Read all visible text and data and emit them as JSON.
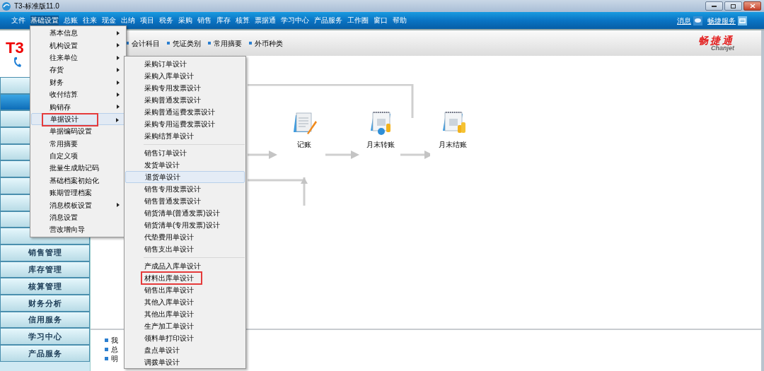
{
  "window": {
    "title": "T3-标准版11.0"
  },
  "menu_bar": {
    "items": [
      {
        "label": "文件",
        "selected": false
      },
      {
        "label": "基础设置",
        "selected": true
      },
      {
        "label": "总账",
        "selected": false
      },
      {
        "label": "往来",
        "selected": false
      },
      {
        "label": "现金",
        "selected": false
      },
      {
        "label": "出纳",
        "selected": false
      },
      {
        "label": "项目",
        "selected": false
      },
      {
        "label": "税务",
        "selected": false
      },
      {
        "label": "采购",
        "selected": false
      },
      {
        "label": "销售",
        "selected": false
      },
      {
        "label": "库存",
        "selected": false
      },
      {
        "label": "核算",
        "selected": false
      },
      {
        "label": "票据通",
        "selected": false
      },
      {
        "label": "学习中心",
        "selected": false
      },
      {
        "label": "产品服务",
        "selected": false
      },
      {
        "label": "工作圈",
        "selected": false
      },
      {
        "label": "窗口",
        "selected": false
      },
      {
        "label": "帮助",
        "selected": false
      }
    ],
    "links": [
      {
        "label": "消息",
        "kind": "message"
      },
      {
        "label": "畅捷服务",
        "kind": "service"
      }
    ]
  },
  "logo": {
    "text": "T3"
  },
  "brand": {
    "name": "畅捷通",
    "sub": "Chanjet"
  },
  "toolbar": {
    "items": [
      "会计科目",
      "凭证类别",
      "常用摘要",
      "外币种类"
    ]
  },
  "sidebar": {
    "items": [
      {
        "selected": false
      },
      {
        "selected": true
      },
      {
        "selected": false
      },
      {
        "selected": false
      },
      {
        "selected": false
      },
      {
        "selected": false
      },
      {
        "selected": false
      },
      {
        "selected": false
      },
      {
        "selected": false
      },
      {
        "selected": false
      },
      {
        "label": "销售管理",
        "selected": false
      },
      {
        "label": "库存管理",
        "selected": false
      },
      {
        "label": "核算管理",
        "selected": false
      },
      {
        "label": "财务分析",
        "selected": false
      },
      {
        "label": "信用服务",
        "selected": false
      },
      {
        "label": "学习中心",
        "selected": false
      },
      {
        "label": "产品服务",
        "selected": false
      }
    ]
  },
  "flow": {
    "nodes": [
      {
        "label": "记账",
        "kind": "ledger"
      },
      {
        "label": "月末转账",
        "kind": "transfer"
      },
      {
        "label": "月末结账",
        "kind": "close"
      }
    ]
  },
  "bottom_panel": {
    "items": [
      "我",
      "总",
      "明"
    ]
  },
  "dropdown_menu": {
    "items": [
      {
        "label": "基本信息",
        "submenu": true,
        "selected": false,
        "annotated": false
      },
      {
        "label": "机构设置",
        "submenu": true,
        "selected": false,
        "annotated": false
      },
      {
        "label": "往来单位",
        "submenu": true,
        "selected": false,
        "annotated": false
      },
      {
        "label": "存货",
        "submenu": true,
        "selected": false,
        "annotated": false
      },
      {
        "label": "财务",
        "submenu": true,
        "selected": false,
        "annotated": false
      },
      {
        "label": "收付结算",
        "submenu": true,
        "selected": false,
        "annotated": false
      },
      {
        "label": "购销存",
        "submenu": true,
        "selected": false,
        "annotated": false
      },
      {
        "label": "单据设计",
        "submenu": true,
        "selected": true,
        "annotated": true
      },
      {
        "label": "单据编码设置",
        "submenu": false,
        "selected": false,
        "annotated": false
      },
      {
        "label": "常用摘要",
        "submenu": false,
        "selected": false,
        "annotated": false
      },
      {
        "label": "自定义项",
        "submenu": false,
        "selected": false,
        "annotated": false
      },
      {
        "label": "批量生成助记码",
        "submenu": false,
        "selected": false,
        "annotated": false
      },
      {
        "label": "基础档案初始化",
        "submenu": false,
        "selected": false,
        "annotated": false
      },
      {
        "label": "账期管理档案",
        "submenu": false,
        "selected": false,
        "annotated": false
      },
      {
        "label": "消息模板设置",
        "submenu": true,
        "selected": false,
        "annotated": false
      },
      {
        "label": "消息设置",
        "submenu": false,
        "selected": false,
        "annotated": false
      },
      {
        "label": "营改增向导",
        "submenu": false,
        "selected": false,
        "annotated": false
      }
    ]
  },
  "submenu": {
    "groups": [
      {
        "items": [
          {
            "label": "采购订单设计",
            "selected": false,
            "annotated": false
          },
          {
            "label": "采购入库单设计",
            "selected": false,
            "annotated": false
          },
          {
            "label": "采购专用发票设计",
            "selected": false,
            "annotated": false
          },
          {
            "label": "采购普通发票设计",
            "selected": false,
            "annotated": false
          },
          {
            "label": "采购普通运费发票设计",
            "selected": false,
            "annotated": false
          },
          {
            "label": "采购专用运费发票设计",
            "selected": false,
            "annotated": false
          },
          {
            "label": "采购结算单设计",
            "selected": false,
            "annotated": false
          }
        ]
      },
      {
        "items": [
          {
            "label": "销售订单设计",
            "selected": false,
            "annotated": false
          },
          {
            "label": "发货单设计",
            "selected": false,
            "annotated": false
          },
          {
            "label": "退货单设计",
            "selected": true,
            "annotated": false
          },
          {
            "label": "销售专用发票设计",
            "selected": false,
            "annotated": false
          },
          {
            "label": "销售普通发票设计",
            "selected": false,
            "annotated": false
          },
          {
            "label": "销货清单(普通发票)设计",
            "selected": false,
            "annotated": false
          },
          {
            "label": "销货清单(专用发票)设计",
            "selected": false,
            "annotated": false
          },
          {
            "label": "代垫费用单设计",
            "selected": false,
            "annotated": false
          },
          {
            "label": "销售支出单设计",
            "selected": false,
            "annotated": false
          }
        ]
      },
      {
        "items": [
          {
            "label": "产成品入库单设计",
            "selected": false,
            "annotated": false
          },
          {
            "label": "材料出库单设计",
            "selected": false,
            "annotated": true
          },
          {
            "label": "销售出库单设计",
            "selected": false,
            "annotated": false
          },
          {
            "label": "其他入库单设计",
            "selected": false,
            "annotated": false
          },
          {
            "label": "其他出库单设计",
            "selected": false,
            "annotated": false
          },
          {
            "label": "生产加工单设计",
            "selected": false,
            "annotated": false
          },
          {
            "label": "领料单打印设计",
            "selected": false,
            "annotated": false
          },
          {
            "label": "盘点单设计",
            "selected": false,
            "annotated": false
          },
          {
            "label": "调拨单设计",
            "selected": false,
            "annotated": false
          }
        ]
      }
    ]
  }
}
